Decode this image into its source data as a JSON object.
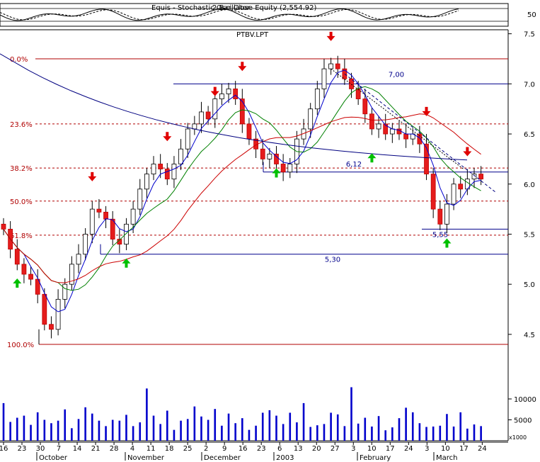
{
  "header": {
    "indicator_title": "Equis - Stochastic Oscillator",
    "overlap_title": "2 Bar Close  Equity (2,554.92)",
    "indicator_tick": "50",
    "ticker": "PTBV.LPT"
  },
  "chart_data": {
    "type": "candlestick",
    "ticker": "PTBV.LPT",
    "y_ticks": [
      4.5,
      5.0,
      5.5,
      6.0,
      6.5,
      7.0,
      7.5
    ],
    "y_tick_labels": [
      "4.5",
      "5.0",
      "5.5",
      "6.0",
      "6.5",
      "7.0",
      "7.5"
    ],
    "fib_levels": [
      {
        "label": "0.0%",
        "price": 7.25
      },
      {
        "label": "23.6%",
        "price": 6.6
      },
      {
        "label": "38.2%",
        "price": 6.16
      },
      {
        "label": "50.0%",
        "price": 5.83
      },
      {
        "label": "61.8%",
        "price": 5.49
      },
      {
        "label": "100.0%",
        "price": 4.4
      }
    ],
    "support_lines": [
      {
        "label": "7,00",
        "price": 7.0
      },
      {
        "label": "6,12",
        "price": 6.12
      },
      {
        "label": "5,55",
        "price": 5.55
      },
      {
        "label": "5,30",
        "price": 5.3
      }
    ],
    "volume_ticks": [
      5000,
      10000
    ],
    "volume_tick_labels": [
      "5000",
      "10000"
    ],
    "volume_unit": "x1000",
    "x_day_labels": [
      "16",
      "23",
      "30",
      "7",
      "14",
      "21",
      "28",
      "4",
      "11",
      "18",
      "25",
      "2",
      "9",
      "16",
      "23",
      "6",
      "13",
      "20",
      "27",
      "3",
      "10",
      "17",
      "24",
      "3",
      "10",
      "17",
      "24"
    ],
    "x_month_labels": [
      "October",
      "November",
      "December",
      "2003",
      "February",
      "March"
    ],
    "closes": [
      5.55,
      5.35,
      5.2,
      5.1,
      5.05,
      4.9,
      4.6,
      4.55,
      4.85,
      5.0,
      5.2,
      5.3,
      5.5,
      5.75,
      5.72,
      5.65,
      5.45,
      5.4,
      5.6,
      5.75,
      5.95,
      6.1,
      6.2,
      6.15,
      6.05,
      6.2,
      6.35,
      6.55,
      6.6,
      6.72,
      6.65,
      6.85,
      6.9,
      6.95,
      6.85,
      6.6,
      6.45,
      6.35,
      6.25,
      6.3,
      6.2,
      6.12,
      6.2,
      6.45,
      6.55,
      6.75,
      6.95,
      7.15,
      7.2,
      7.15,
      7.05,
      6.95,
      6.85,
      6.7,
      6.55,
      6.6,
      6.5,
      6.55,
      6.5,
      6.45,
      6.5,
      6.4,
      6.1,
      5.75,
      5.6,
      5.8,
      6.0,
      5.95,
      6.05,
      6.1,
      6.05
    ],
    "volumes": [
      9000,
      4500,
      5500,
      6000,
      3800,
      6800,
      5000,
      4200,
      4800,
      7500,
      3000,
      5200,
      8000,
      6500,
      4800,
      3500,
      5000,
      4800,
      6200,
      3500,
      4400,
      12500,
      6000,
      4000,
      7200,
      2600,
      4800,
      5200,
      8200,
      5800,
      5000,
      7600,
      3600,
      6500,
      4200,
      5400,
      2600,
      3600,
      6700,
      7300,
      6000,
      4000,
      6700,
      4400,
      9000,
      3300,
      3700,
      4000,
      6700,
      6300,
      3500,
      12800,
      4100,
      5500,
      3400,
      5900,
      2500,
      3200,
      5400,
      7900,
      6800,
      4200,
      3300,
      3400,
      3600,
      6400,
      3400,
      6800,
      2900,
      3900,
      3500
    ]
  }
}
